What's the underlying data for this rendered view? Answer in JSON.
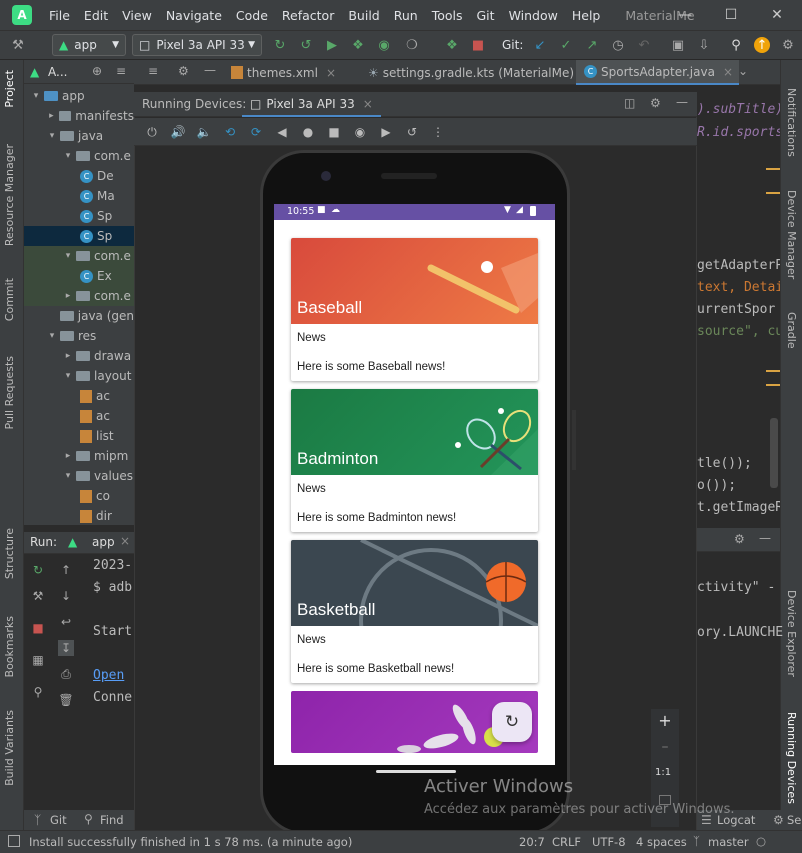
{
  "menu": {
    "items": [
      "File",
      "Edit",
      "View",
      "Navigate",
      "Code",
      "Refactor",
      "Build",
      "Run",
      "Tools",
      "Git",
      "Window",
      "Help"
    ],
    "window_title": "MaterialMe"
  },
  "toolbar": {
    "run_config": "app",
    "device": "Pixel 3a API 33",
    "git_label": "Git:"
  },
  "project": {
    "header": "A...",
    "rows": [
      {
        "label": "app",
        "level": 0,
        "kind": "folder-blue",
        "open": true
      },
      {
        "label": "manifests",
        "level": 1,
        "kind": "folder",
        "open": false
      },
      {
        "label": "java",
        "level": 1,
        "kind": "folder",
        "open": true
      },
      {
        "label": "com.e",
        "level": 2,
        "kind": "folder",
        "open": true
      },
      {
        "label": "De",
        "level": 3,
        "kind": "class"
      },
      {
        "label": "Ma",
        "level": 3,
        "kind": "class"
      },
      {
        "label": "Sp",
        "level": 3,
        "kind": "class"
      },
      {
        "label": "Sp",
        "level": 3,
        "kind": "class",
        "selected": true
      },
      {
        "label": "com.e",
        "level": 2,
        "kind": "folder",
        "open": true,
        "green": true
      },
      {
        "label": "Ex",
        "level": 3,
        "kind": "class",
        "green": true
      },
      {
        "label": "com.e",
        "level": 2,
        "kind": "folder",
        "open": false,
        "green": true
      },
      {
        "label": "java (gen",
        "level": 1,
        "kind": "folder"
      },
      {
        "label": "res",
        "level": 1,
        "kind": "folder",
        "open": true
      },
      {
        "label": "drawa",
        "level": 2,
        "kind": "folder",
        "open": false
      },
      {
        "label": "layout",
        "level": 2,
        "kind": "folder",
        "open": true
      },
      {
        "label": "ac",
        "level": 3,
        "kind": "xml"
      },
      {
        "label": "ac",
        "level": 3,
        "kind": "xml"
      },
      {
        "label": "list",
        "level": 3,
        "kind": "xml"
      },
      {
        "label": "mipm",
        "level": 2,
        "kind": "folder",
        "open": false
      },
      {
        "label": "values",
        "level": 2,
        "kind": "folder",
        "open": true
      },
      {
        "label": "co",
        "level": 3,
        "kind": "xml"
      },
      {
        "label": "dir",
        "level": 3,
        "kind": "xml"
      }
    ]
  },
  "editor_tabs": [
    "themes.xml",
    "settings.gradle.kts (MaterialMe)",
    "SportsAdapter.java"
  ],
  "code_lines": [
    {
      "text": ").subTitle);",
      "color": "#9876aa"
    },
    {
      "text": "R.id.sports",
      "color": "#9876aa"
    },
    {
      "text": "getAdapterP",
      "color": "#bbbbbb"
    },
    {
      "text": "text, Detai",
      "color": "#cc7832"
    },
    {
      "text": "urrentSpor",
      "color": "#bbbbbb"
    },
    {
      "text": "source\", cu",
      "color": "#6a8759"
    },
    {
      "text": "tle());",
      "color": "#bbbbbb"
    },
    {
      "text": "o());",
      "color": "#bbbbbb"
    },
    {
      "text": "t.getImageR",
      "color": "#bbbbbb"
    }
  ],
  "running_devices": {
    "title": "Running Devices:",
    "tab": "Pixel 3a API 33"
  },
  "phone": {
    "time": "10:55",
    "cards": [
      {
        "title": "Baseball",
        "subtitle": "News",
        "info": "Here is some Baseball news!",
        "color": "#e05c3b"
      },
      {
        "title": "Badminton",
        "subtitle": "News",
        "info": "Here is some Badminton news!",
        "color": "#1e8a4c"
      },
      {
        "title": "Basketball",
        "subtitle": "News",
        "info": "Here is some Basketball news!",
        "color": "#3d4a52"
      },
      {
        "title": "",
        "subtitle": "",
        "info": "",
        "color": "#9c27b0"
      }
    ]
  },
  "run": {
    "label": "Run:",
    "config": "app",
    "lines": [
      "2023-",
      "$ adb",
      "Start",
      "Open",
      "Conne"
    ],
    "right_lines": [
      "ctivity\" -",
      "ory.LAUNCHE"
    ]
  },
  "zoom": {
    "ratio": "1:1"
  },
  "right_stripe": [
    "Notifications",
    "Device Manager",
    "Gradle",
    "Device Explorer",
    "Running Devices"
  ],
  "left_stripe": [
    "Project",
    "Resource Manager",
    "Commit",
    "Pull Requests",
    "Structure",
    "Bookmarks",
    "Build Variants"
  ],
  "bottom_tabs": {
    "git": "Git",
    "find": "Find",
    "logcat": "Logcat",
    "se": "Se"
  },
  "status": {
    "message": "Install successfully finished in 1 s 78 ms. (a minute ago)",
    "position": "20:7",
    "line_sep": "CRLF",
    "encoding": "UTF-8",
    "indent": "4 spaces",
    "branch": "master"
  },
  "watermark": {
    "line1": "Activer Windows",
    "line2": "Accédez aux paramètres pour activer Windows."
  }
}
